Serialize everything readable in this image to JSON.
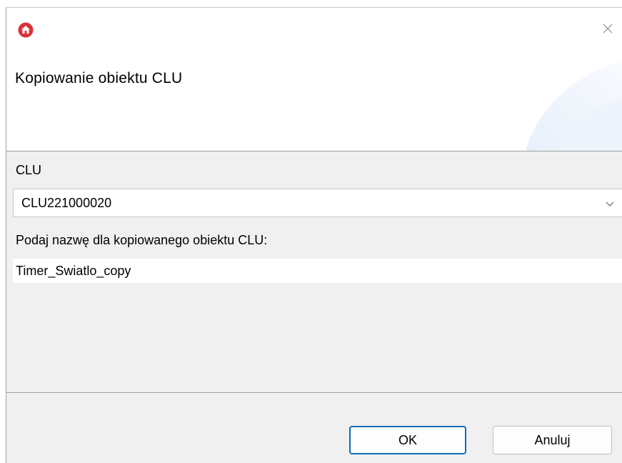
{
  "window": {
    "app_icon": "home-icon",
    "close_icon": "close-icon"
  },
  "header": {
    "title": "Kopiowanie obiektu CLU"
  },
  "form": {
    "clu_label": "CLU",
    "clu_selected": "CLU221000020",
    "name_label": "Podaj nazwę dla kopiowanego obiektu CLU:",
    "name_value": "Timer_Swiatlo_copy"
  },
  "buttons": {
    "ok_label": "OK",
    "cancel_label": "Anuluj"
  },
  "colors": {
    "brand": "#d9323a",
    "focus_border": "#0f6cbd",
    "dialog_bg": "#f0f0f0"
  }
}
